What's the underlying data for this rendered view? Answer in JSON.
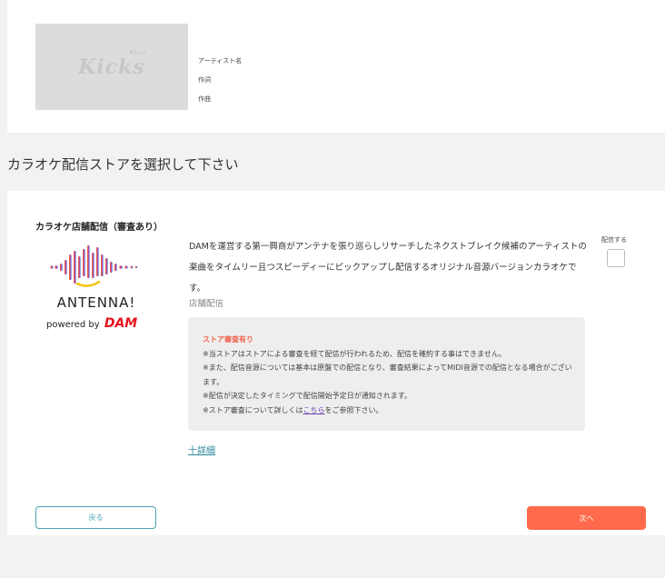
{
  "song": {
    "jacket_logo": "Kicks",
    "jacket_logo_sup": "Blue",
    "artist_label": "アーティスト名",
    "lyricist_label": "作詞",
    "composer_label": "作曲"
  },
  "section_heading": "カラオケ配信ストアを選択して下さい",
  "store": {
    "title": "カラオケ店舗配信（審査あり）",
    "logo_text": "ANTENNA!",
    "powered_by": "powered by",
    "dam": "DAM",
    "description": "DAMを運営する第一興商がアンテナを張り巡らしリサーチしたネクストブレイク候補のアーティストの楽曲をタイムリー且つスピーディーにピックアップし配信するオリジナル音源バージョンカラオケです。",
    "type": "店舗配信",
    "publish_label": "配信する",
    "notice": {
      "title": "ストア審査有り",
      "line1": "※当ストアはストアによる審査を経て配信が行われるため、配信を確約する事はできません。",
      "line2": "※また、配信音源については基本は原盤での配信となり、審査結果によってMIDI音源での配信となる場合がございます。",
      "line3": "※配信が決定したタイミングで配信開始予定日が通知されます。",
      "line4_pre": "※ストア審査について詳しくは",
      "line4_link": "こちら",
      "line4_post": "をご参照下さい。"
    },
    "detail_link": "十詳細"
  },
  "footer": {
    "back_label": "戻る",
    "next_label": "次へ"
  },
  "colors": {
    "accent_orange": "#ff6a4d",
    "accent_teal": "#4aa3b4",
    "notice_red": "#f26450",
    "dam_red": "#e8121b"
  }
}
